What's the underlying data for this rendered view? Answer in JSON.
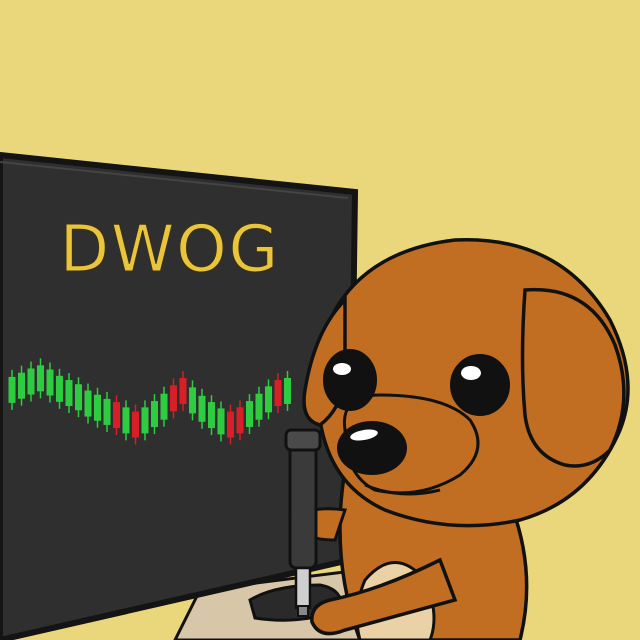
{
  "screen": {
    "title": "DWOG"
  },
  "colors": {
    "background": "#ead77c",
    "monitor": "#2e2f2e",
    "monitor_border": "#141414",
    "title_text": "#e8c53c",
    "candle_up": "#2ecc40",
    "candle_down": "#d61f26",
    "dog_fur": "#c26e22",
    "dog_belly": "#ead1a6",
    "marker": "#3a3a3a"
  },
  "chart_data": {
    "type": "candlestick",
    "candles": [
      {
        "dir": "up",
        "y": 62
      },
      {
        "dir": "up",
        "y": 66
      },
      {
        "dir": "up",
        "y": 70
      },
      {
        "dir": "up",
        "y": 73
      },
      {
        "dir": "up",
        "y": 69
      },
      {
        "dir": "up",
        "y": 63
      },
      {
        "dir": "up",
        "y": 59
      },
      {
        "dir": "up",
        "y": 55
      },
      {
        "dir": "up",
        "y": 49
      },
      {
        "dir": "up",
        "y": 45
      },
      {
        "dir": "up",
        "y": 41
      },
      {
        "dir": "down",
        "y": 38
      },
      {
        "dir": "up",
        "y": 33
      },
      {
        "dir": "down",
        "y": 29
      },
      {
        "dir": "up",
        "y": 33
      },
      {
        "dir": "up",
        "y": 39
      },
      {
        "dir": "up",
        "y": 46
      },
      {
        "dir": "down",
        "y": 54
      },
      {
        "dir": "down",
        "y": 61
      },
      {
        "dir": "up",
        "y": 52
      },
      {
        "dir": "up",
        "y": 44
      },
      {
        "dir": "up",
        "y": 38
      },
      {
        "dir": "up",
        "y": 32
      },
      {
        "dir": "down",
        "y": 29
      },
      {
        "dir": "down",
        "y": 33
      },
      {
        "dir": "up",
        "y": 39
      },
      {
        "dir": "up",
        "y": 46
      },
      {
        "dir": "up",
        "y": 53
      },
      {
        "dir": "down",
        "y": 59
      },
      {
        "dir": "up",
        "y": 61
      }
    ]
  }
}
